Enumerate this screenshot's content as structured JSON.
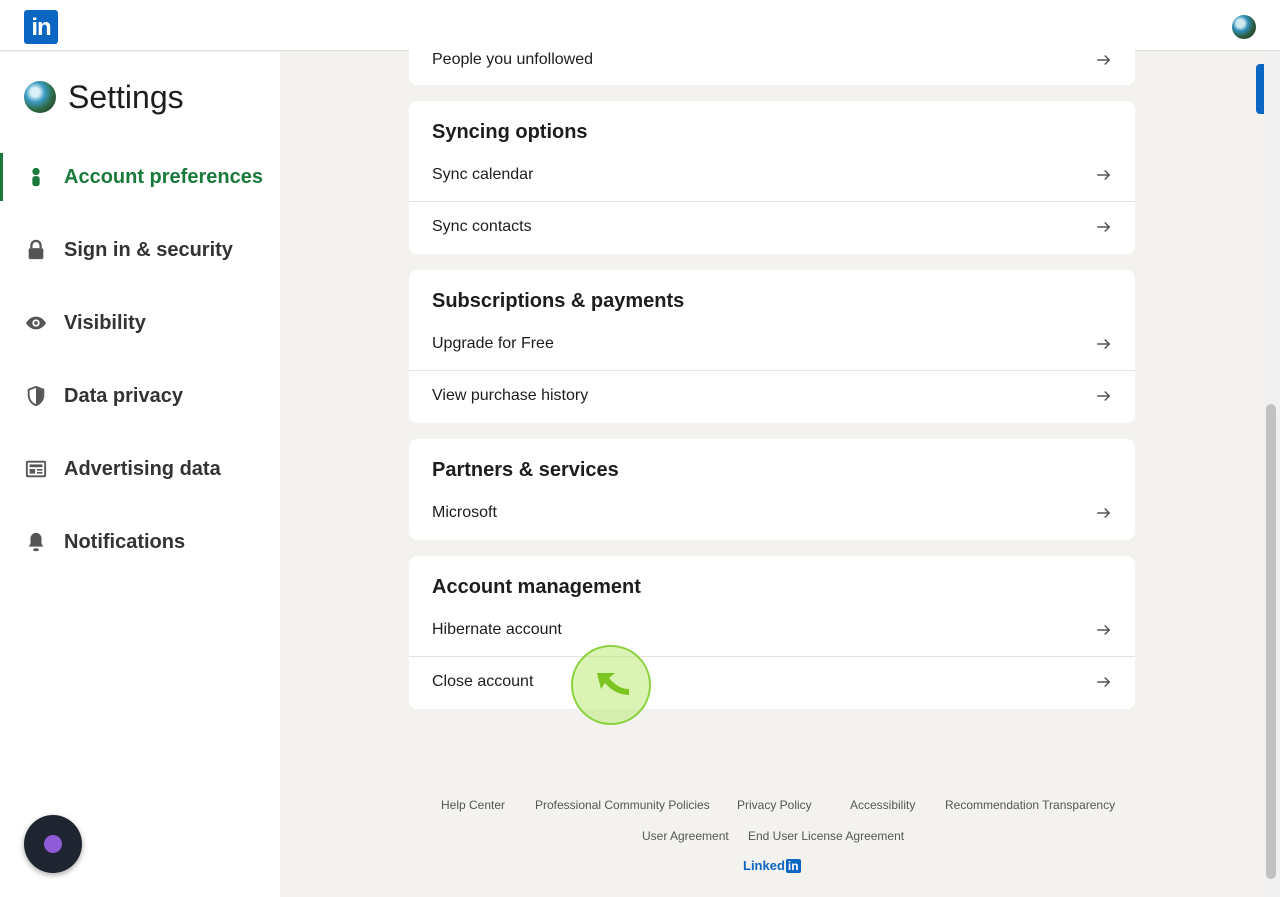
{
  "topbar": {
    "logo_text": "in"
  },
  "sidebar": {
    "title": "Settings",
    "items": [
      {
        "label": "Account preferences",
        "icon": "person-icon",
        "active": true
      },
      {
        "label": "Sign in & security",
        "icon": "lock-icon",
        "active": false
      },
      {
        "label": "Visibility",
        "icon": "eye-icon",
        "active": false
      },
      {
        "label": "Data privacy",
        "icon": "shield-icon",
        "active": false
      },
      {
        "label": "Advertising data",
        "icon": "newspaper-icon",
        "active": false
      },
      {
        "label": "Notifications",
        "icon": "bell-icon",
        "active": false
      }
    ]
  },
  "main": {
    "partial_row": "People you unfollowed",
    "sections": [
      {
        "title": "Syncing options",
        "rows": [
          "Sync calendar",
          "Sync contacts"
        ]
      },
      {
        "title": "Subscriptions & payments",
        "rows": [
          "Upgrade for Free",
          "View purchase history"
        ]
      },
      {
        "title": "Partners & services",
        "rows": [
          "Microsoft"
        ]
      },
      {
        "title": "Account management",
        "rows": [
          "Hibernate account",
          "Close account"
        ]
      }
    ]
  },
  "footer": {
    "links": [
      "Help Center",
      "Professional Community Policies",
      "Privacy Policy",
      "Accessibility",
      "Recommendation Transparency",
      "User Agreement",
      "End User License Agreement"
    ],
    "brand_word": "Linked",
    "brand_in": "in"
  },
  "colors": {
    "accent": "#1a7a3c",
    "brand": "#0a66c2",
    "cursor": "#8bd13d"
  }
}
